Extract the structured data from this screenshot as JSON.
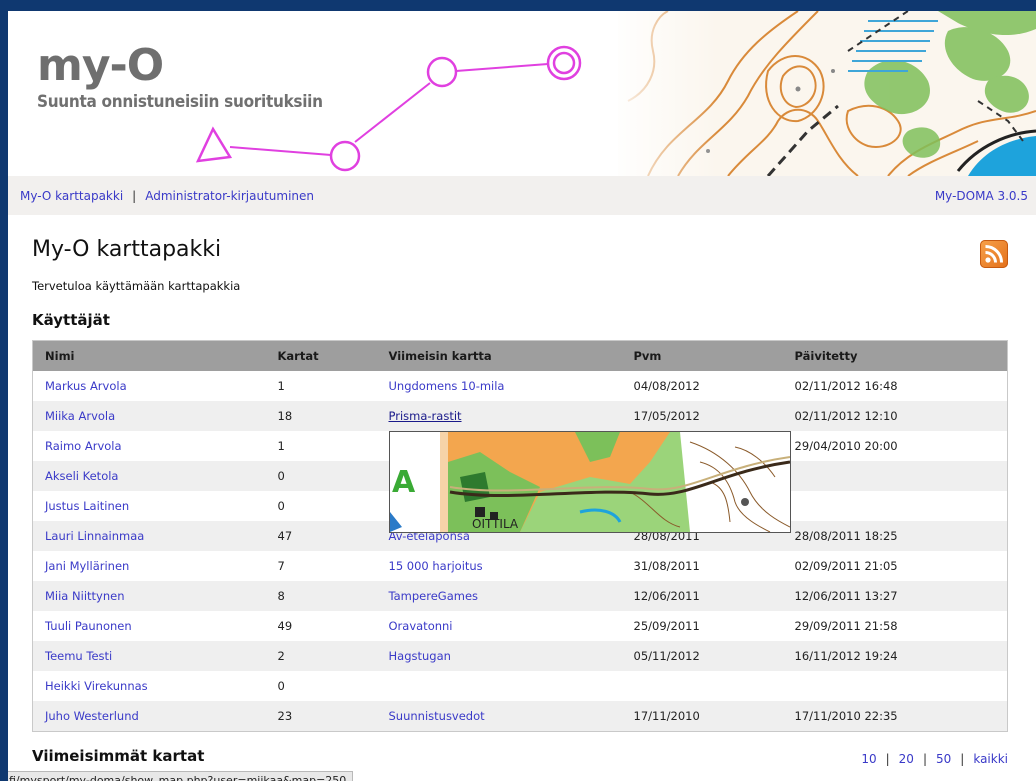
{
  "header": {
    "logo_text": "my-O",
    "tagline": "Suunta onnistuneisiin suorituksiin"
  },
  "nav": {
    "link1": "My-O karttapakki",
    "separator": "|",
    "link2": "Administrator-kirjautuminen",
    "version": "My-DOMA 3.0.5"
  },
  "page": {
    "title": "My-O karttapakki",
    "welcome": "Tervetuloa käyttämään karttapakkia",
    "rss_icon": "rss-feed-icon",
    "users_heading": "Käyttäjät",
    "recent_heading": "Viimeisimmät kartat"
  },
  "users_table": {
    "headers": [
      "Nimi",
      "Kartat",
      "Viimeisin kartta",
      "Pvm",
      "Päivitetty"
    ],
    "rows": [
      {
        "name": "Markus Arvola",
        "maps": "1",
        "latest": "Ungdomens 10-mila",
        "date": "04/08/2012",
        "updated": "02/11/2012 16:48"
      },
      {
        "name": "Miika Arvola",
        "maps": "18",
        "latest": "Prisma-rastit",
        "date": "17/05/2012",
        "updated": "02/11/2012 12:10"
      },
      {
        "name": "Raimo Arvola",
        "maps": "1",
        "latest": "",
        "date": "",
        "updated": "29/04/2010 20:00"
      },
      {
        "name": "Akseli Ketola",
        "maps": "0",
        "latest": "",
        "date": "",
        "updated": ""
      },
      {
        "name": "Justus Laitinen",
        "maps": "0",
        "latest": "",
        "date": "",
        "updated": ""
      },
      {
        "name": "Lauri Linnainmaa",
        "maps": "47",
        "latest": "Av-etelaponsa",
        "date": "28/08/2011",
        "updated": "28/08/2011 18:25"
      },
      {
        "name": "Jani Myllärinen",
        "maps": "7",
        "latest": "15 000 harjoitus",
        "date": "31/08/2011",
        "updated": "02/09/2011 21:05"
      },
      {
        "name": "Miia Niittynen",
        "maps": "8",
        "latest": "TampereGames",
        "date": "12/06/2011",
        "updated": "12/06/2011 13:27"
      },
      {
        "name": "Tuuli Paunonen",
        "maps": "49",
        "latest": "Oravatonni",
        "date": "25/09/2011",
        "updated": "29/09/2011 21:58"
      },
      {
        "name": "Teemu Testi",
        "maps": "2",
        "latest": "Hagstugan",
        "date": "05/11/2012",
        "updated": "16/11/2012 19:24"
      },
      {
        "name": "Heikki Virekunnas",
        "maps": "0",
        "latest": "",
        "date": "",
        "updated": ""
      },
      {
        "name": "Juho Westerlund",
        "maps": "23",
        "latest": "Suunnistusvedot",
        "date": "17/11/2010",
        "updated": "17/11/2010 22:35"
      }
    ]
  },
  "preview": {
    "label": "OITTILA",
    "map_letters": "A"
  },
  "pager": {
    "options": [
      "10",
      "20",
      "50",
      "kaikki"
    ],
    "separator": "|"
  },
  "status": {
    "url": "fi/mysport/my-doma/show_map.php?user=miikaa&map=250"
  },
  "colors": {
    "link": "#3a3ac8",
    "header_bg": "#9e9e9e",
    "row_alt": "#efefef",
    "frame": "#0f3870",
    "course": "#e040e0"
  }
}
